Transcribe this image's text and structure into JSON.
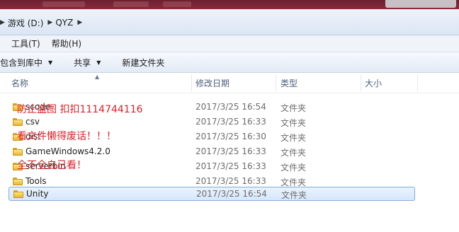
{
  "breadcrumb": [
    "游戏 (D:)",
    "QYZ"
  ],
  "menu": [
    "工具(T)",
    "帮助(H)"
  ],
  "toolbar": {
    "include": "包含到库中",
    "share": "共享",
    "new_folder": "新建文件夹"
  },
  "columns": {
    "name": "名称",
    "date": "修改日期",
    "type": "类型",
    "size": "大小"
  },
  "files": [
    {
      "name": "scode",
      "date": "2017/3/25 16:54",
      "type": "文件夹"
    },
    {
      "name": "csv",
      "date": "2017/3/25 16:33",
      "type": "文件夹"
    },
    {
      "name": "dist",
      "date": "2017/3/25 16:30",
      "type": "文件夹"
    },
    {
      "name": "GameWindows4.2.0",
      "date": "2017/3/25 16:33",
      "type": "文件夹"
    },
    {
      "name": "serverbin",
      "date": "2017/3/25 16:33",
      "type": "文件夹"
    },
    {
      "name": "Tools",
      "date": "2017/3/25 16:33",
      "type": "文件夹"
    },
    {
      "name": "Unity",
      "date": "2017/3/25 16:54",
      "type": "文件夹",
      "selected": true
    }
  ],
  "watermarks": [
    "防止盗图 扣扣1114744116",
    "看文件懒得废话！！！",
    "全不全自己看！"
  ]
}
